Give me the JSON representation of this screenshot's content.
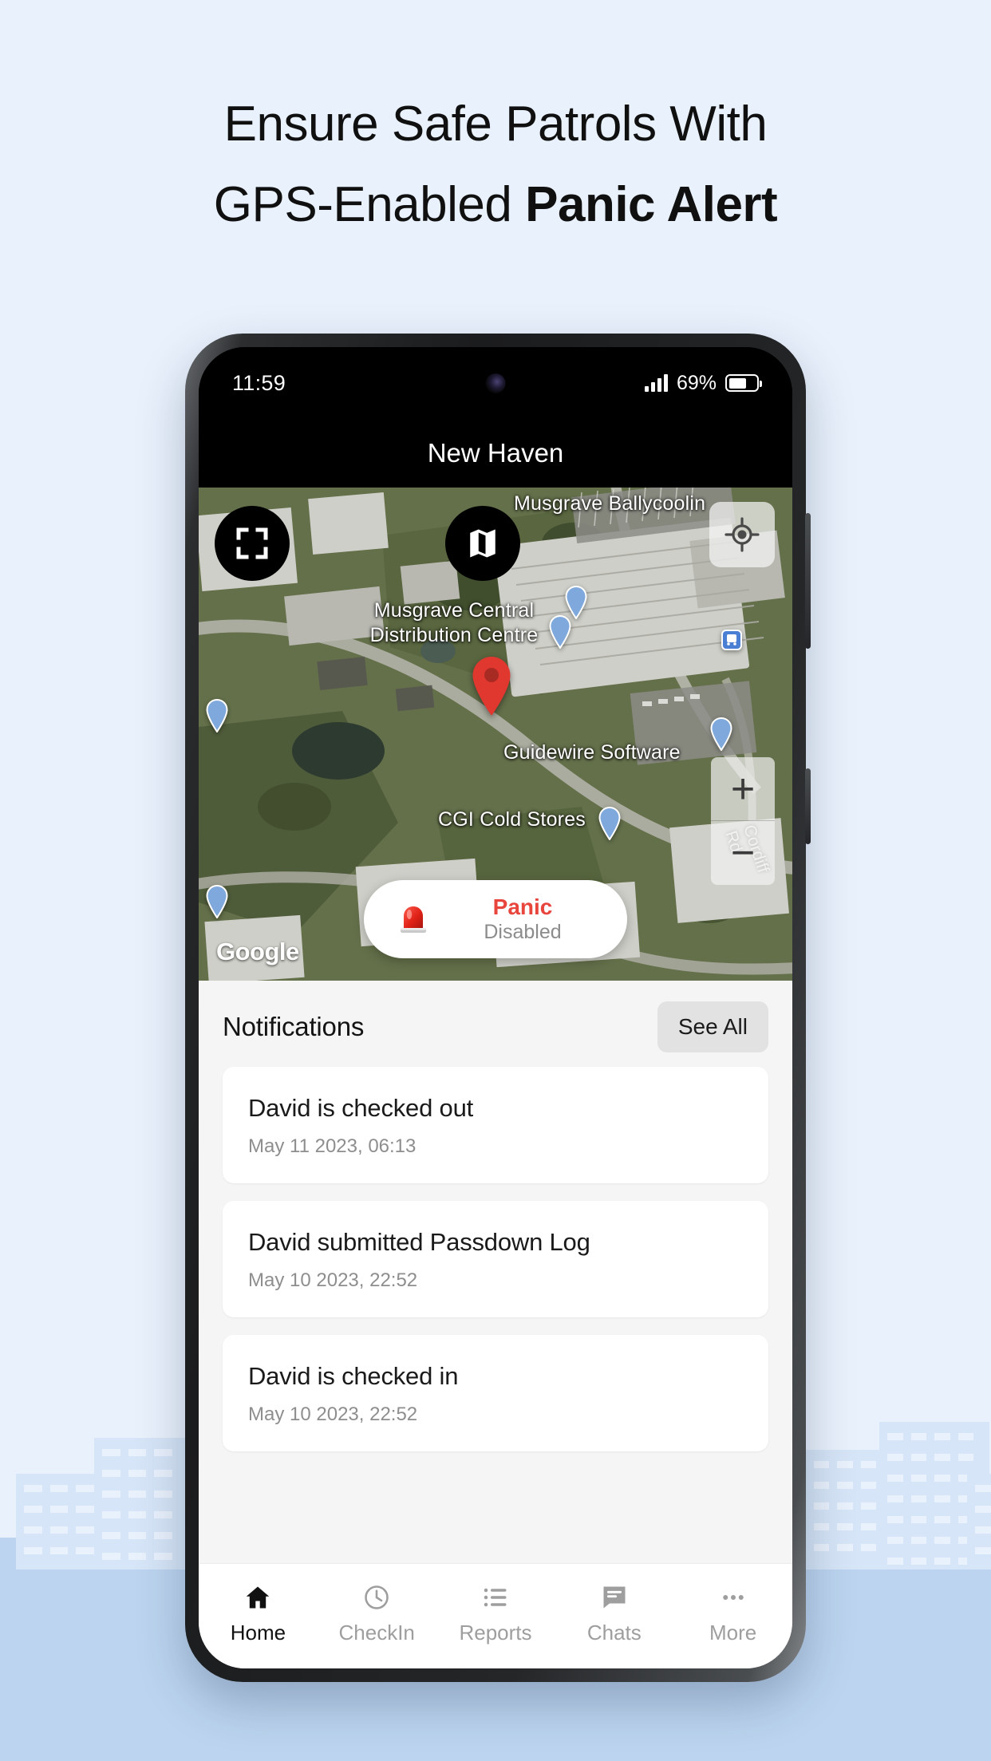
{
  "headline": {
    "line1": "Ensure Safe Patrols With",
    "line2_normal": "GPS-Enabled ",
    "line2_strong": "Panic Alert"
  },
  "phone": {
    "status_bar": {
      "time": "11:59",
      "battery_percent": "69%",
      "signal_icon": "signal-bars-icon",
      "battery_icon": "battery-icon"
    },
    "app_title": "New Haven"
  },
  "map": {
    "attribution": "Google",
    "labels": [
      {
        "text": "Musgrave Ballycoolin"
      },
      {
        "text": "Musgrave Central"
      },
      {
        "text": "Distribution Centre"
      },
      {
        "text": "Guidewire Software"
      },
      {
        "text": "CGI Cold Stores"
      },
      {
        "text": "Cordiff Rd"
      }
    ],
    "controls": {
      "fullscreen": "fullscreen-icon",
      "layers": "map-layers-icon",
      "my_location": "my-location-icon",
      "zoom_in": "+",
      "zoom_out": "−"
    },
    "panic_button": {
      "icon": "siren-icon",
      "title": "Panic",
      "status": "Disabled",
      "title_color": "#e8453c",
      "status_color": "#8c8c8c"
    }
  },
  "notifications": {
    "heading": "Notifications",
    "see_all_label": "See All",
    "items": [
      {
        "title": "David is checked out",
        "date": "May 11 2023, 06:13"
      },
      {
        "title": "David submitted Passdown Log",
        "date": "May 10 2023, 22:52"
      },
      {
        "title": "David is checked in",
        "date": "May 10 2023, 22:52"
      }
    ]
  },
  "bottom_nav": {
    "active_index": 0,
    "items": [
      {
        "label": "Home",
        "icon": "home-icon"
      },
      {
        "label": "CheckIn",
        "icon": "clock-icon"
      },
      {
        "label": "Reports",
        "icon": "list-icon"
      },
      {
        "label": "Chats",
        "icon": "chat-icon"
      },
      {
        "label": "More",
        "icon": "ellipsis-icon"
      }
    ]
  },
  "theme": {
    "page_bg": "#e9f1fc",
    "page_bg_bottom": "#bcd4ef",
    "accent_red": "#e8453c"
  }
}
